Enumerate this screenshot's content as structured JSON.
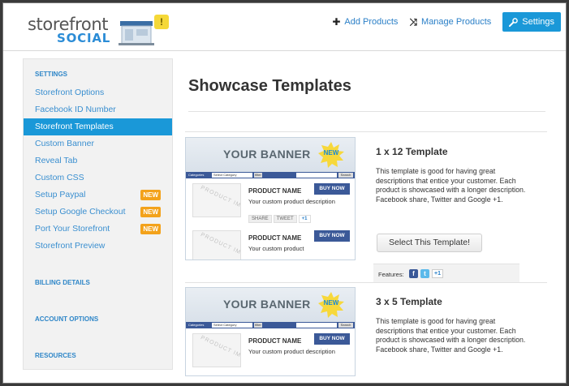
{
  "brand": {
    "word1": "storefront",
    "word2": "SOCIAL",
    "exclaim": "!"
  },
  "top_nav": {
    "add_products": "Add Products",
    "manage_products": "Manage Products",
    "settings": "Settings"
  },
  "sidebar": {
    "settings_heading": "SETTINGS",
    "items": [
      {
        "label": "Storefront Options"
      },
      {
        "label": "Facebook ID Number"
      },
      {
        "label": "Storefront Templates"
      },
      {
        "label": "Custom Banner"
      },
      {
        "label": "Reveal Tab"
      },
      {
        "label": "Custom CSS"
      },
      {
        "label": "Setup Paypal",
        "badge": "NEW"
      },
      {
        "label": "Setup Google Checkout",
        "badge": "NEW"
      },
      {
        "label": "Port Your Storefront",
        "badge": "NEW"
      },
      {
        "label": "Storefront Preview"
      }
    ],
    "billing_heading": "BILLING DETAILS",
    "account_heading": "ACCOUNT OPTIONS",
    "resources_heading": "RESOURCES"
  },
  "main": {
    "title": "Showcase Templates"
  },
  "preview": {
    "banner": "YOUR BANNER",
    "new_burst": "NEW",
    "categories": "Categories",
    "select_category": "Select Category",
    "filter": "filter",
    "search": "Search",
    "product_image": "PRODUCT IMAGE",
    "product_name": "PRODUCT NAME",
    "buy_now": "BUY NOW",
    "desc_full": "Your custom product description",
    "desc_cut": "Your custom product",
    "share": "SHARE",
    "tweet": "TWEET",
    "plus1": "+1"
  },
  "templates": [
    {
      "title": "1 x 12 Template",
      "desc": "This template is good for having great descriptions that entice your customer. Each product is showcased with a longer description. Facebook share, Twitter and Google +1.",
      "button": "Select This Template!",
      "features_label": "Features:"
    },
    {
      "title": "3 x 5 Template",
      "desc": "This template is good for having great descriptions that entice your customer. Each product is showcased with a longer description. Facebook share, Twitter and Google +1."
    }
  ],
  "feature_icons": {
    "facebook": "f",
    "twitter": "t",
    "google": "+1"
  },
  "colors": {
    "accent": "#1a98d8",
    "link": "#2a7fc7",
    "badge": "#f3a21b",
    "facebook": "#3b5998"
  }
}
